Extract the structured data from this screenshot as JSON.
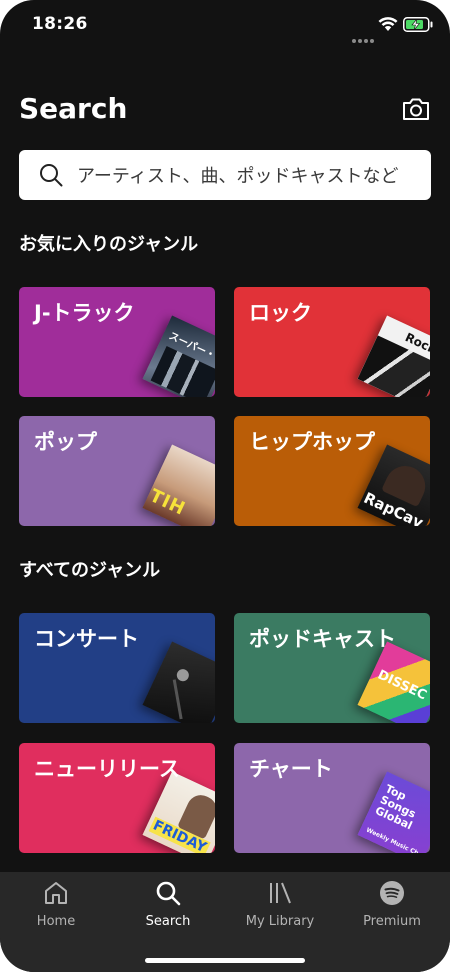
{
  "status": {
    "time": "18:26"
  },
  "header": {
    "title": "Search"
  },
  "search": {
    "placeholder": "アーティスト、曲、ポッドキャストなど"
  },
  "sections": {
    "favorites": "お気に入りのジャンル",
    "all": "すべてのジャンル"
  },
  "tiles": [
    {
      "label": "J-トラック",
      "color": "#a02d9a",
      "art_text": "スーパー・ビ"
    },
    {
      "label": "ロック",
      "color": "#e13238",
      "art_text": "Rock"
    },
    {
      "label": "ポップ",
      "color": "#8d67ab",
      "art_text": "TIH"
    },
    {
      "label": "ヒップホップ",
      "color": "#ba5d07",
      "art_text": "RapCav"
    },
    {
      "label": "コンサート",
      "color": "#223f86",
      "art_text": ""
    },
    {
      "label": "ポッドキャスト",
      "color": "#3b7b62",
      "art_text": "DISSEC"
    },
    {
      "label": "ニューリリース",
      "color": "#e02e5e",
      "art_text": "FRIDAY"
    },
    {
      "label": "チャート",
      "color": "#8d67ab",
      "art_text": "Top Songs Global",
      "art_sub": "Weekly Music Ch"
    }
  ],
  "tabs": [
    {
      "label": "Home",
      "icon": "home-icon"
    },
    {
      "label": "Search",
      "icon": "search-icon",
      "active": true
    },
    {
      "label": "My Library",
      "icon": "library-icon"
    },
    {
      "label": "Premium",
      "icon": "spotify-icon"
    }
  ]
}
